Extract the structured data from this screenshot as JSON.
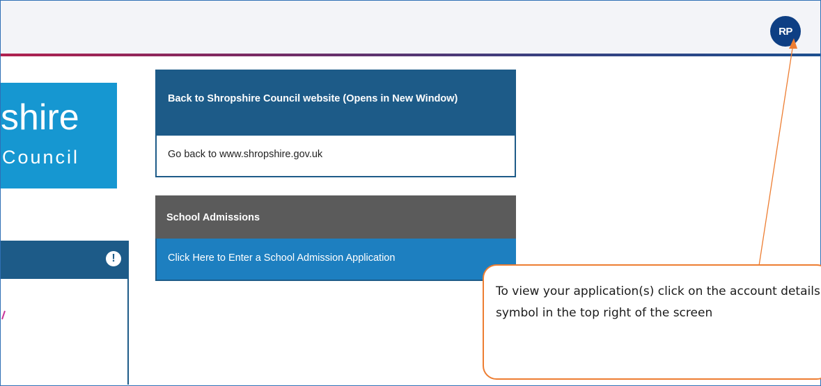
{
  "header": {
    "avatar_initials": "RP"
  },
  "logo": {
    "word": "shire",
    "sub": "Council"
  },
  "cards": {
    "website": {
      "title": "Back to Shropshire Council website (Opens in New Window)",
      "link": "Go back to www.shropshire.gov.uk"
    },
    "admissions": {
      "title": "School Admissions",
      "link": "Click Here to Enter a School Admission Application"
    }
  },
  "left_panel": {
    "alert_symbol": "!"
  },
  "callout": {
    "text": "To view your application(s) click on the account details symbol in the top right of the screen"
  },
  "colors": {
    "accent_blue": "#1d5b88",
    "link_blue": "#1d7fc0",
    "avatar": "#0e3f84",
    "callout_border": "#ed7d31"
  },
  "icons": [
    "user-avatar-icon",
    "alert-icon",
    "shropshire-council-logo"
  ]
}
